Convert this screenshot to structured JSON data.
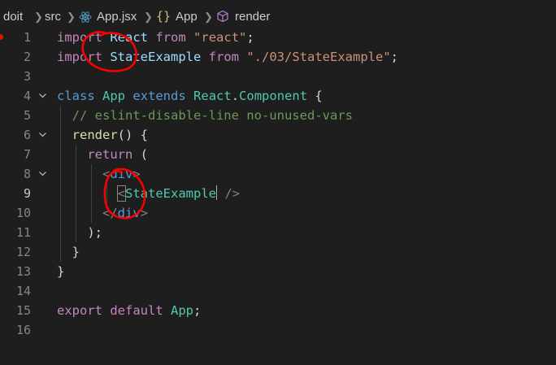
{
  "breadcrumb": {
    "items": [
      "doit",
      "src",
      "App.jsx",
      "App",
      "render"
    ],
    "icons": [
      "react-icon",
      "brace-icon",
      "cube-icon"
    ]
  },
  "editor": {
    "line_numbers": [
      "1",
      "2",
      "3",
      "4",
      "5",
      "6",
      "7",
      "8",
      "9",
      "10",
      "11",
      "12",
      "13",
      "14",
      "15",
      "16"
    ],
    "active_line": 9,
    "code": {
      "l1": {
        "import": "import",
        "name": "React",
        "from": "from",
        "src": "\"react\"",
        "semi": ";"
      },
      "l2": {
        "import": "import",
        "name": "StateExample",
        "from": "from",
        "src": "\"./03/StateExample\"",
        "semi": ";"
      },
      "l4": {
        "class": "class",
        "name": "App",
        "extends": "extends",
        "base1": "React",
        "dot": ".",
        "base2": "Component",
        "brace": "{"
      },
      "l5": {
        "comment": "// eslint-disable-line no-unused-vars"
      },
      "l6": {
        "fn": "render",
        "rest": "() {"
      },
      "l7": {
        "ret": "return",
        "paren": "("
      },
      "l8": {
        "open": "<",
        "tag": "div",
        "close": ">"
      },
      "l9": {
        "open": "<",
        "comp": "StateExample",
        "close": " />"
      },
      "l10": {
        "open": "</",
        "tag": "div",
        "close": ">"
      },
      "l11": {
        "text": ");"
      },
      "l12": {
        "text": "}"
      },
      "l13": {
        "text": "}"
      },
      "l15": {
        "export": "export",
        "default": "default",
        "name": "App",
        "semi": ";"
      }
    }
  },
  "colors": {
    "background": "#1e1e1e",
    "keyword": "#569cd6",
    "control": "#c586c0",
    "class": "#4ec9b0",
    "string": "#ce9178",
    "comment": "#6a9955",
    "annotation": "#ff0000"
  }
}
